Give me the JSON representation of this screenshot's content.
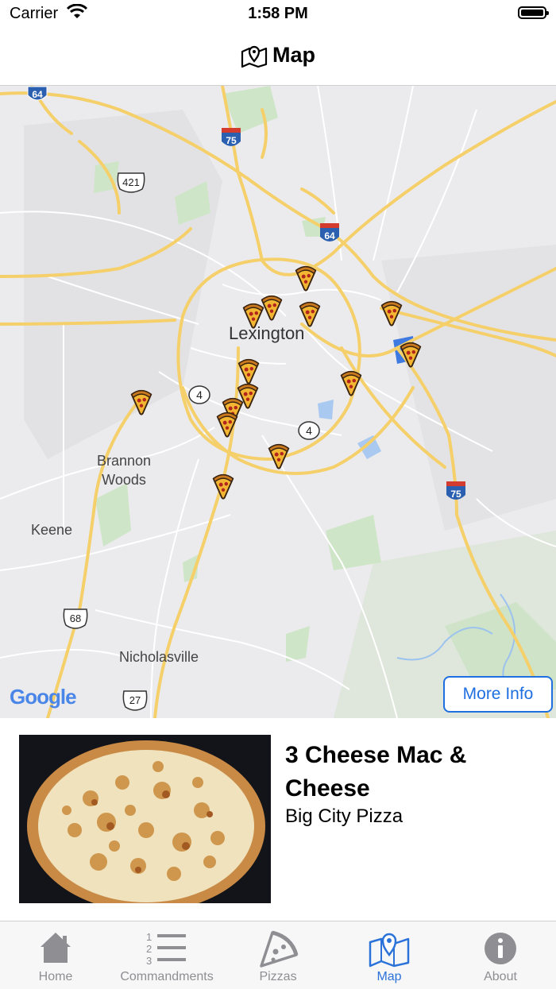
{
  "status_bar": {
    "carrier": "Carrier",
    "time": "1:58 PM"
  },
  "navbar": {
    "title": "Map",
    "icon": "map-pin-icon"
  },
  "map": {
    "city_labels": {
      "lexington": "Lexington",
      "brannon_woods": "Brannon\nWoods",
      "keene": "Keene",
      "nicholasville": "Nicholasville"
    },
    "route_shields": {
      "i64_top": "64",
      "i75_top": "75",
      "us421": "421",
      "i64_mid": "64",
      "ky4_left": "4",
      "ky4_right": "4",
      "i75_bottom": "75",
      "us68": "68",
      "us27": "27"
    },
    "attribution": "Google",
    "more_info_label": "More Info",
    "pin_icon": "pizza-slice-icon"
  },
  "selected_pizza": {
    "name": "3 Cheese Mac & Cheese",
    "restaurant": "Big City Pizza"
  },
  "tab_bar": {
    "tabs": [
      {
        "label": "Home",
        "icon": "home-icon"
      },
      {
        "label": "Commandments",
        "icon": "numbered-list-icon"
      },
      {
        "label": "Pizzas",
        "icon": "pizza-icon"
      },
      {
        "label": "Map",
        "icon": "map-icon",
        "active": true
      },
      {
        "label": "About",
        "icon": "info-icon"
      }
    ]
  },
  "colors": {
    "accent": "#2b72d9",
    "road_major": "#f7d36a",
    "road_minor": "#ffffff",
    "map_bg": "#e8e8ea"
  }
}
